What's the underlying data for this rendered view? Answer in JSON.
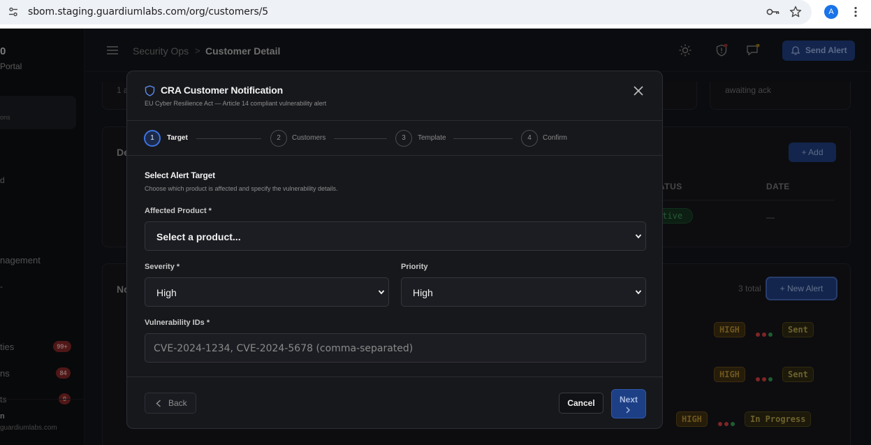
{
  "browser": {
    "url": "sbom.staging.guardiumlabs.com/org/customers/5",
    "profile_initial": "A"
  },
  "sidebar": {
    "brand_title": "0",
    "brand_sub": "Portal",
    "active_item_text": "ons",
    "items": [
      {
        "label": "d"
      },
      {
        "label": "nagement"
      },
      {
        "label": "-"
      },
      {
        "label": "ties",
        "badge": "99+"
      },
      {
        "label": "ns",
        "badge": "84"
      },
      {
        "label": "ts",
        "badge": "0"
      }
    ],
    "user_name": "n",
    "user_email": "guardiumlabs.com"
  },
  "topbar": {
    "breadcrumb_parent": "Security Ops",
    "breadcrumb_separator": ">",
    "breadcrumb_current": "Customer Detail",
    "send_alert_label": "Send Alert"
  },
  "background": {
    "card_top_left_text": "1 a",
    "card_top_right_text": "awaiting ack",
    "section1_title": "De",
    "add_label": "+ Add",
    "col_status": "ATUS",
    "col_date": "DATE",
    "status_pill": "ctive",
    "date_value": "—",
    "section2_title": "No",
    "total_label": "3 total",
    "new_alert_label": "+ New Alert",
    "alerts": [
      {
        "severity": "HIGH",
        "status": "Sent"
      },
      {
        "severity": "HIGH",
        "status": "Sent"
      },
      {
        "severity": "HIGH",
        "status": "In Progress"
      }
    ]
  },
  "modal": {
    "title": "CRA Customer Notification",
    "subtitle": "EU Cyber Resilience Act — Article 14 compliant vulnerability alert",
    "steps": [
      {
        "num": "1",
        "label": "Target",
        "active": true
      },
      {
        "num": "2",
        "label": "Customers",
        "active": false
      },
      {
        "num": "3",
        "label": "Template",
        "active": false
      },
      {
        "num": "4",
        "label": "Confirm",
        "active": false
      }
    ],
    "section_title": "Select Alert Target",
    "section_sub": "Choose which product is affected and specify the vulnerability details.",
    "affected_product_label": "Affected Product *",
    "affected_product_value": "Select a product...",
    "severity_label": "Severity *",
    "severity_value": "High",
    "priority_label": "Priority",
    "priority_value": "High",
    "vuln_ids_label": "Vulnerability IDs *",
    "vuln_ids_placeholder": "CVE-2024-1234, CVE-2024-5678 (comma-separated)",
    "back_label": "Back",
    "cancel_label": "Cancel",
    "next_label": "Next"
  },
  "colors": {
    "accent": "#3d73e0",
    "modal_bg": "#17181c",
    "high_badge": "#a8842e",
    "status_dot_red": "#c2393a",
    "status_dot_green": "#2f8f4c"
  }
}
